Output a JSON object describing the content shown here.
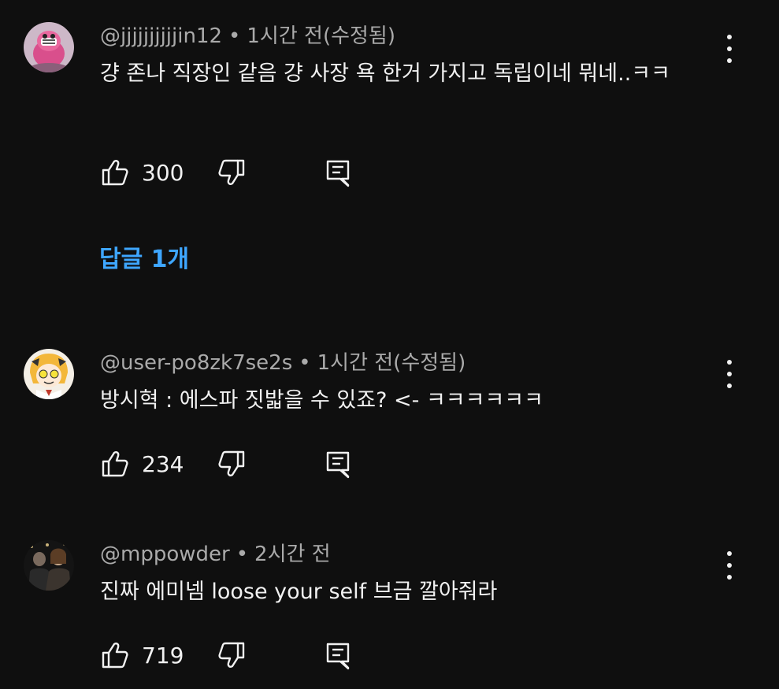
{
  "comments": [
    {
      "username": "@jjjjjjjjjjin12",
      "separator": "•",
      "time": "1시간 전(수정됨)",
      "text": "걍 존나 직장인 같음 걍 사장 욕 한거 가지고 독립이네 뭐네..ㅋㅋ",
      "likes": "300",
      "replies_label": "답글 1개"
    },
    {
      "username": "@user-po8zk7se2s",
      "separator": "•",
      "time": "1시간 전(수정됨)",
      "text": "방시혁 : 에스파 짓밟을 수 있죠? <-  ㅋㅋㅋㅋㅋㅋ",
      "likes": "234"
    },
    {
      "username": "@mppowder",
      "separator": "•",
      "time": "2시간 전",
      "text": "진짜 에미넴 loose your self 브금 깔아줘라",
      "likes": "719"
    }
  ],
  "icons": {
    "like": "thumbs-up-icon",
    "dislike": "thumbs-down-icon",
    "reply": "reply-comment-icon",
    "menu": "more-vertical-icon"
  },
  "colors": {
    "background": "#0f0f0f",
    "text": "#f1f1f1",
    "secondary_text": "#aaaaaa",
    "link": "#3ea6ff"
  }
}
